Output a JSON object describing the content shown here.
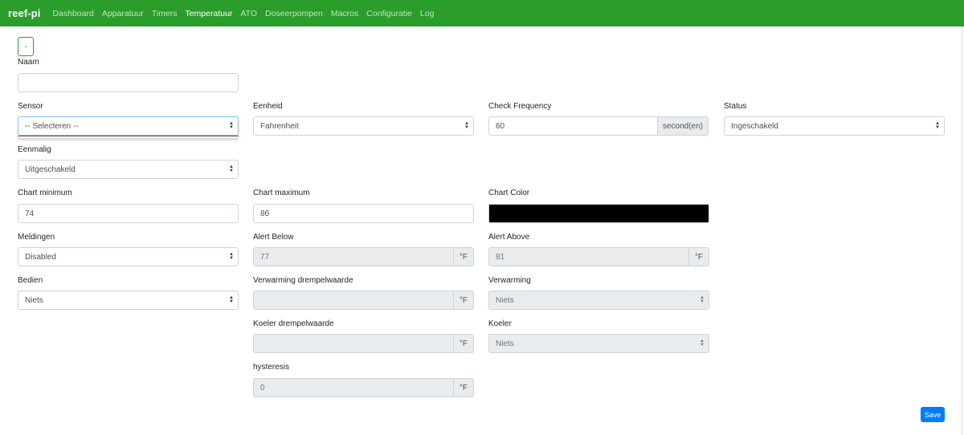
{
  "nav": {
    "brand": "reef-pi",
    "items": [
      "Dashboard",
      "Apparatuur",
      "Timers",
      "Temperatuur",
      "ATO",
      "Doseerpompen",
      "Macros",
      "Configuratie",
      "Log"
    ]
  },
  "form": {
    "collapse_label": "-",
    "naam": {
      "label": "Naam",
      "value": ""
    },
    "sensor": {
      "label": "Sensor",
      "value": "-- Selecteren --"
    },
    "eenheid": {
      "label": "Eenheid",
      "value": "Fahrenheit"
    },
    "check_frequency": {
      "label": "Check Frequency",
      "value": "60",
      "addon": "second(en)"
    },
    "status": {
      "label": "Status",
      "value": "Ingeschakeld"
    },
    "eenmalig": {
      "label": "Eenmalig",
      "value": "Uitgeschakeld"
    },
    "chart_minimum": {
      "label": "Chart minimum",
      "value": "74"
    },
    "chart_maximum": {
      "label": "Chart maximum",
      "value": "86"
    },
    "chart_color": {
      "label": "Chart Color",
      "color": "#000000"
    },
    "meldingen": {
      "label": "Meldingen",
      "value": "Disabled"
    },
    "alert_below": {
      "label": "Alert Below",
      "value": "77",
      "addon": "°F"
    },
    "alert_above": {
      "label": "Alert Above",
      "value": "81",
      "addon": "°F"
    },
    "bedien": {
      "label": "Bedien",
      "value": "Niets"
    },
    "verwarming_drempel": {
      "label": "Verwarming drempelwaarde",
      "value": "",
      "addon": "°F"
    },
    "verwarming": {
      "label": "Verwarming",
      "value": "Niets"
    },
    "koeler_drempel": {
      "label": "Koeler drempelwaarde",
      "value": "",
      "addon": "°F"
    },
    "koeler": {
      "label": "Koeler",
      "value": "Niets"
    },
    "hysteresis": {
      "label": "hysteresis",
      "value": "0",
      "addon": "°F"
    },
    "save_label": "Save"
  },
  "colors": {
    "navbar": "#2a9d2b",
    "primary": "#007bff",
    "chart_color": "#000000"
  }
}
